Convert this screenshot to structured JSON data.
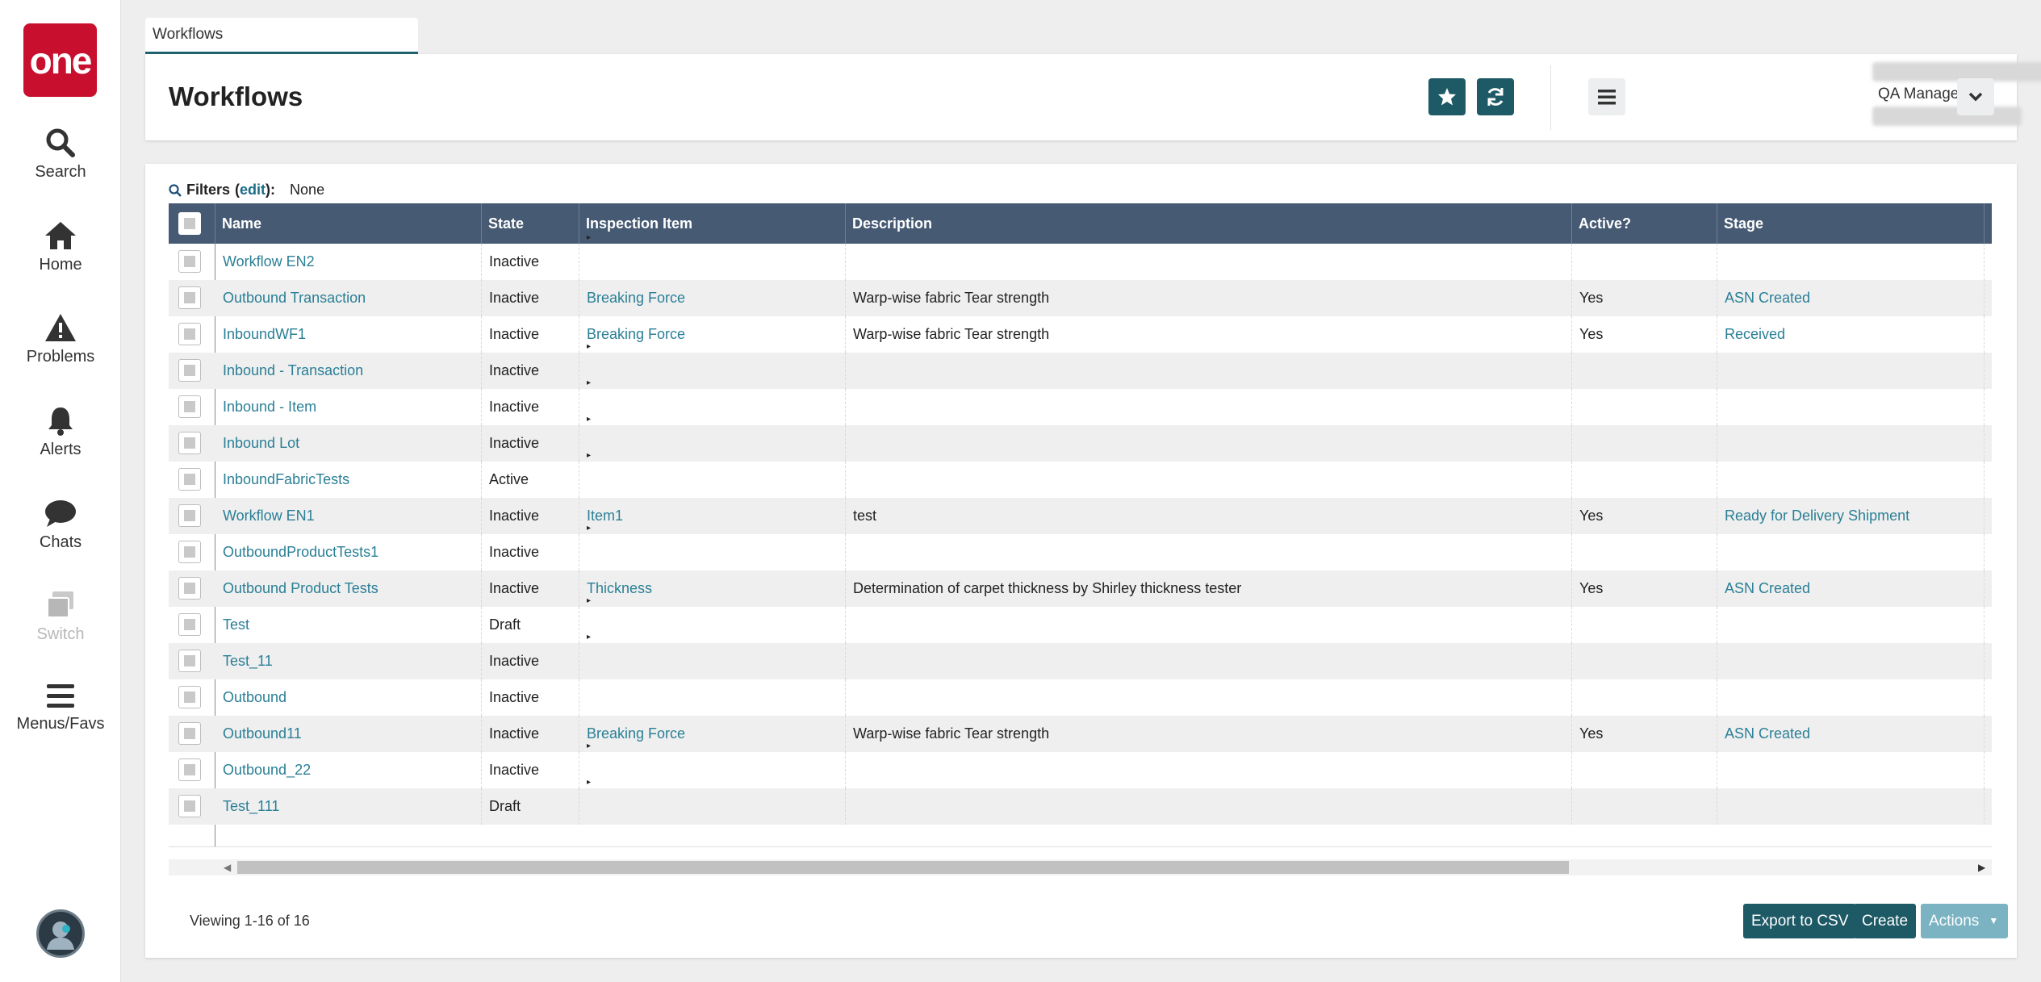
{
  "nav": {
    "logo": "one",
    "items": [
      {
        "label": "Search",
        "icon": "search-icon"
      },
      {
        "label": "Home",
        "icon": "home-icon"
      },
      {
        "label": "Problems",
        "icon": "warning-icon"
      },
      {
        "label": "Alerts",
        "icon": "bell-icon"
      },
      {
        "label": "Chats",
        "icon": "chat-icon"
      },
      {
        "label": "Switch",
        "icon": "switch-icon"
      },
      {
        "label": "Menus/Favs",
        "icon": "menu-icon"
      }
    ]
  },
  "tab": {
    "label": "Workflows"
  },
  "header": {
    "title": "Workflows",
    "role": "QA Manager"
  },
  "filters": {
    "label": "Filters",
    "edit": "edit",
    "value": "None"
  },
  "table": {
    "columns": [
      "Name",
      "State",
      "Inspection Item",
      "Description",
      "Active?",
      "Stage"
    ],
    "rows": [
      {
        "name": "Workflow EN2",
        "state": "Inactive",
        "item": "",
        "description": "",
        "active": "",
        "stage": "",
        "caret": true
      },
      {
        "name": "Outbound Transaction",
        "state": "Inactive",
        "item": "Breaking Force",
        "description": "Warp-wise fabric Tear strength",
        "active": "Yes",
        "stage": "ASN Created",
        "caret": false
      },
      {
        "name": "InboundWF1",
        "state": "Inactive",
        "item": "Breaking Force",
        "description": "Warp-wise fabric Tear strength",
        "active": "Yes",
        "stage": "Received",
        "caret": false
      },
      {
        "name": "Inbound - Transaction",
        "state": "Inactive",
        "item": "",
        "description": "",
        "active": "",
        "stage": "",
        "caret": true
      },
      {
        "name": "Inbound - Item",
        "state": "Inactive",
        "item": "",
        "description": "",
        "active": "",
        "stage": "",
        "caret": true
      },
      {
        "name": "Inbound Lot",
        "state": "Inactive",
        "item": "",
        "description": "",
        "active": "",
        "stage": "",
        "caret": true
      },
      {
        "name": "InboundFabricTests",
        "state": "Active",
        "item": "",
        "description": "",
        "active": "",
        "stage": "",
        "caret": true
      },
      {
        "name": "Workflow EN1",
        "state": "Inactive",
        "item": "Item1",
        "description": "test",
        "active": "Yes",
        "stage": "Ready for Delivery Shipment",
        "caret": false
      },
      {
        "name": "OutboundProductTests1",
        "state": "Inactive",
        "item": "",
        "description": "",
        "active": "",
        "stage": "",
        "caret": true
      },
      {
        "name": "Outbound Product Tests",
        "state": "Inactive",
        "item": "Thickness",
        "description": "Determination of carpet thickness by Shirley thickness tester",
        "active": "Yes",
        "stage": "ASN Created",
        "caret": false
      },
      {
        "name": "Test",
        "state": "Draft",
        "item": "",
        "description": "",
        "active": "",
        "stage": "",
        "caret": true
      },
      {
        "name": "Test_11",
        "state": "Inactive",
        "item": "",
        "description": "",
        "active": "",
        "stage": "",
        "caret": true
      },
      {
        "name": "Outbound",
        "state": "Inactive",
        "item": "",
        "description": "",
        "active": "",
        "stage": "",
        "caret": false
      },
      {
        "name": "Outbound11",
        "state": "Inactive",
        "item": "Breaking Force",
        "description": "Warp-wise fabric Tear strength",
        "active": "Yes",
        "stage": "ASN Created",
        "caret": false
      },
      {
        "name": "Outbound_22",
        "state": "Inactive",
        "item": "",
        "description": "",
        "active": "",
        "stage": "",
        "caret": true
      },
      {
        "name": "Test_111",
        "state": "Draft",
        "item": "",
        "description": "",
        "active": "",
        "stage": "",
        "caret": true
      }
    ]
  },
  "footer": {
    "viewing": "Viewing 1-16 of 16",
    "export": "Export to CSV",
    "create": "Create",
    "actions": "Actions"
  },
  "colors": {
    "header_bg": "#465a73",
    "primary_btn": "#1d5a66",
    "link": "#2a7f96",
    "logo": "#c8102e"
  }
}
